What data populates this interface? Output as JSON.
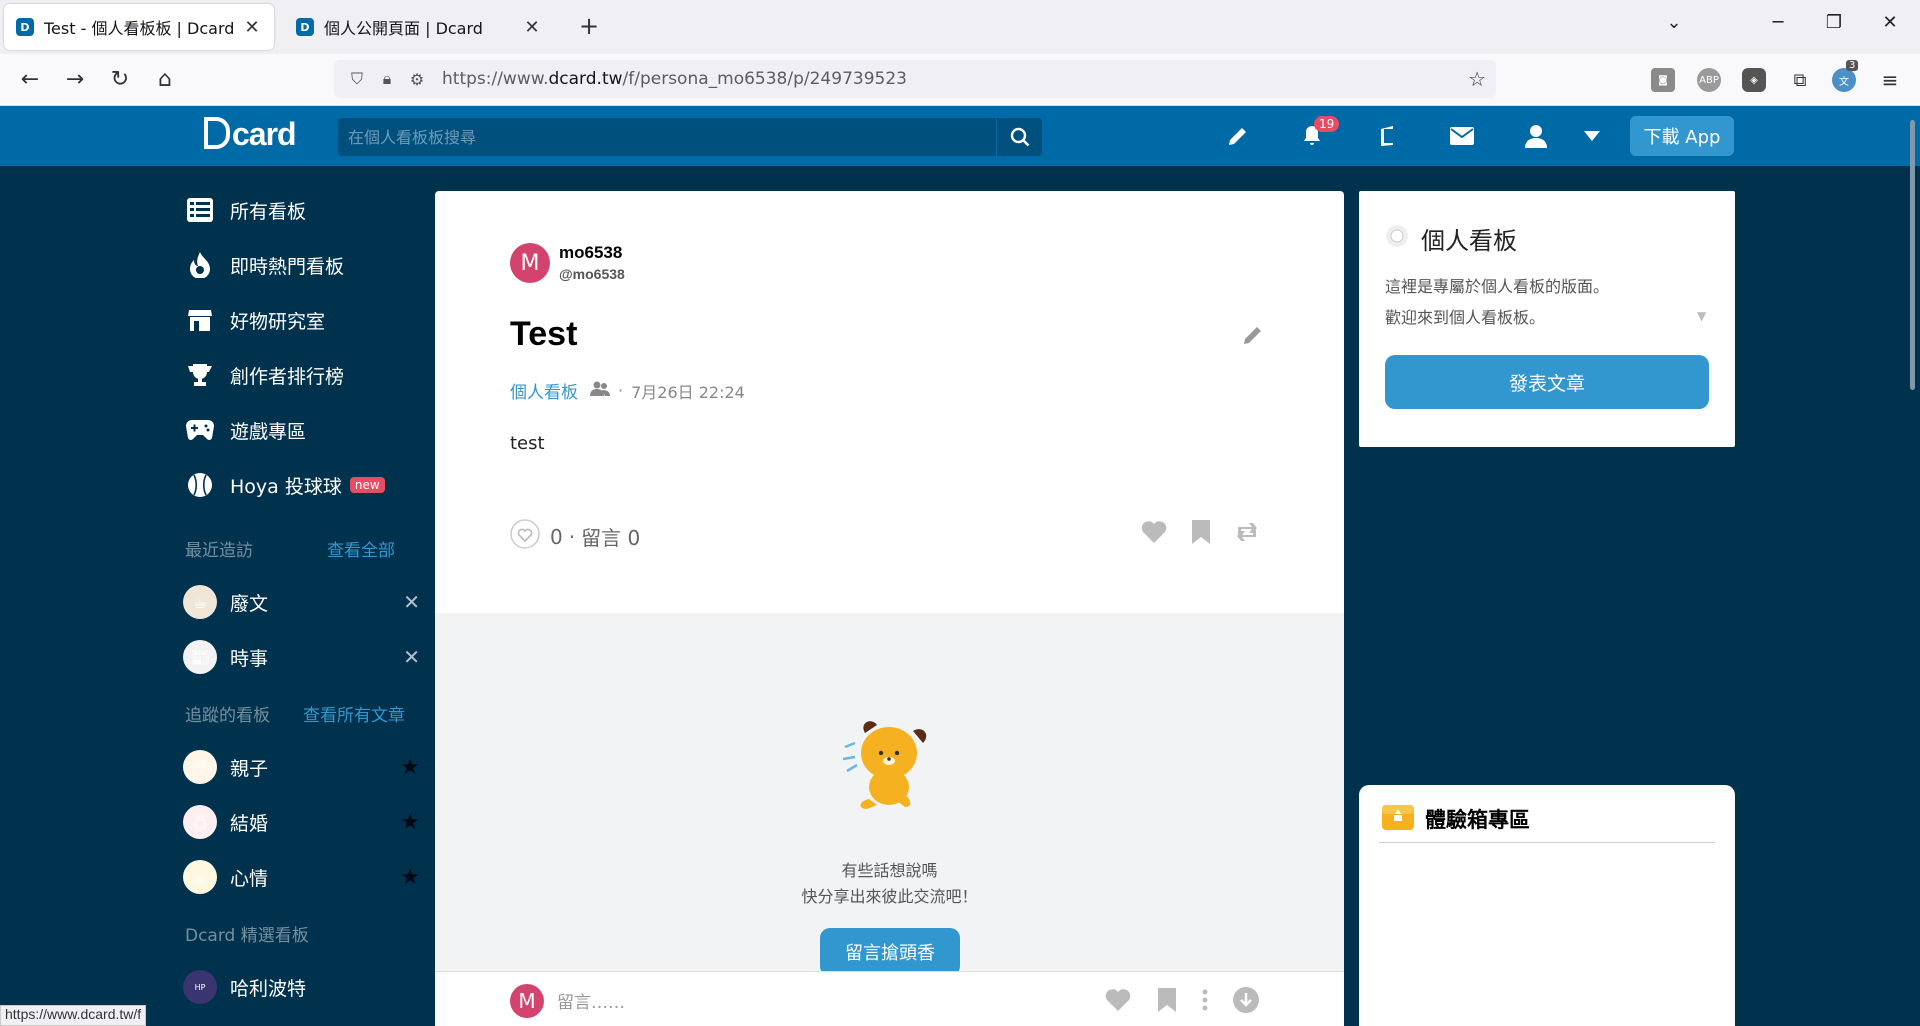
{
  "browser": {
    "tabs": [
      {
        "title": "Test - 個人看板板 | Dcard",
        "active": true
      },
      {
        "title": "個人公開頁面 | Dcard",
        "active": false
      }
    ],
    "url_prefix": "https://www.",
    "url_domain": "dcard.tw",
    "url_path": "/f/persona_mo6538/p/249739523",
    "extension_badge": "3",
    "status_url": "https://www.dcard.tw/f"
  },
  "header": {
    "logo": "card",
    "search_placeholder": "在個人看板板搜尋",
    "notification_count": "19",
    "download_label": "下載 App"
  },
  "sidebar": {
    "main_items": [
      {
        "label": "所有看板",
        "icon": "list-icon"
      },
      {
        "label": "即時熱門看板",
        "icon": "fire-icon"
      },
      {
        "label": "好物研究室",
        "icon": "store-icon"
      },
      {
        "label": "創作者排行榜",
        "icon": "trophy-icon"
      },
      {
        "label": "遊戲專區",
        "icon": "gamepad-icon"
      },
      {
        "label": "Hoya 投球球",
        "icon": "baseball-icon",
        "badge": "new"
      }
    ],
    "recent_label": "最近造訪",
    "recent_link": "查看全部",
    "recent_items": [
      {
        "label": "廢文"
      },
      {
        "label": "時事"
      }
    ],
    "following_label": "追蹤的看板",
    "following_link": "查看所有文章",
    "following_items": [
      {
        "label": "親子"
      },
      {
        "label": "結婚"
      },
      {
        "label": "心情"
      }
    ],
    "featured_label": "Dcard 精選看板",
    "featured_items": [
      {
        "label": "哈利波特"
      }
    ]
  },
  "post": {
    "author_initial": "M",
    "author_name": "mo6538",
    "author_id": "@mo6538",
    "title": "Test",
    "board": "個人看板",
    "date": "7月26日 22:24",
    "body": "test",
    "like_count": "0",
    "comment_text": "留言 0",
    "empty_line1": "有些話想說嗎",
    "empty_line2": "快分享出來彼此交流吧！",
    "first_comment_button": "留言搶頭香",
    "comment_placeholder": "留言……"
  },
  "widget": {
    "title": "個人看板",
    "desc_line1": "這裡是專屬於個人看板的版面。",
    "desc_line2": "歡迎來到個人看板板。",
    "post_button": "發表文章"
  },
  "widget2": {
    "title": "體驗箱專區"
  },
  "colors": {
    "brand": "#006aa6",
    "background": "#00324e",
    "accent": "#3397cf",
    "notification": "#e64c66"
  }
}
